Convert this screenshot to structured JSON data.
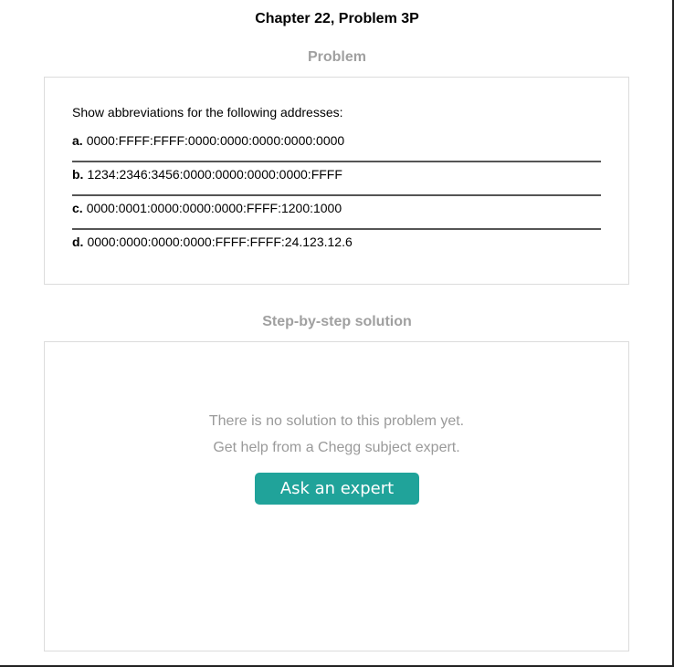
{
  "header": {
    "chapter_title": "Chapter 22, Problem 3P"
  },
  "problem": {
    "heading": "Problem",
    "intro": "Show abbreviations for the following addresses:",
    "parts": [
      {
        "letter": "a.",
        "text": "0000:FFFF:FFFF:0000:0000:0000:0000:0000"
      },
      {
        "letter": "b.",
        "text": "1234:2346:3456:0000:0000:0000:0000:FFFF"
      },
      {
        "letter": "c.",
        "text": "0000:0001:0000:0000:0000:FFFF:1200:1000"
      },
      {
        "letter": "d.",
        "text": "0000:0000:0000:0000:FFFF:FFFF:24.123.12.6"
      }
    ]
  },
  "solution": {
    "heading": "Step-by-step solution",
    "empty_line_1": "There is no solution to this problem yet.",
    "empty_line_2": "Get help from a Chegg subject expert.",
    "ask_button_label": "Ask an expert"
  },
  "colors": {
    "accent": "#20a39a",
    "heading_gray": "#a0a0a0",
    "muted_text": "#9a9a9a",
    "card_border": "#dcdcdc"
  }
}
